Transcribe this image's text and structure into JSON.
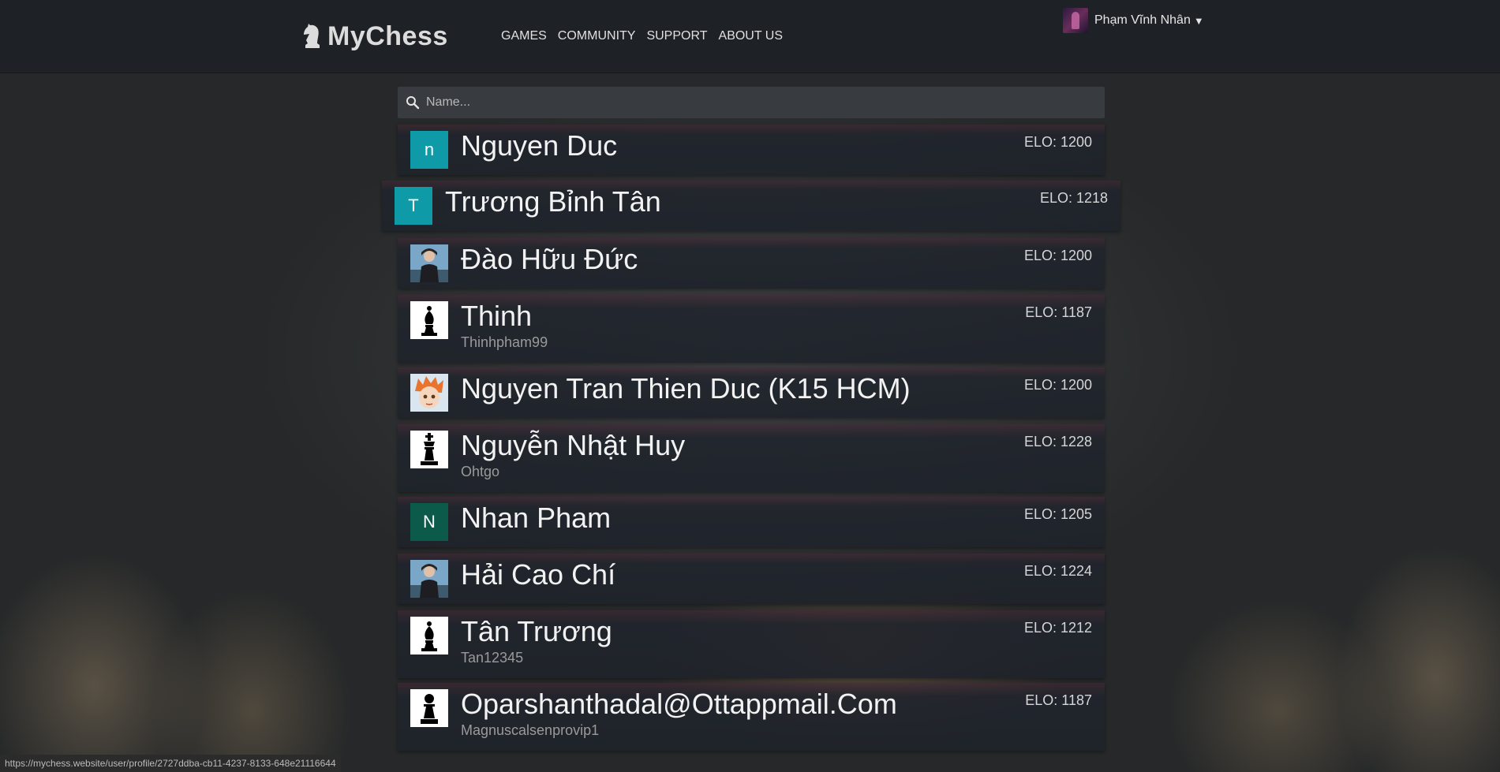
{
  "app": {
    "title": "MyChess",
    "nav": [
      "GAMES",
      "COMMUNITY",
      "SUPPORT",
      "ABOUT US"
    ],
    "user": {
      "name": "Phạm Vĩnh Nhân",
      "caret": "▼"
    }
  },
  "search": {
    "placeholder": "Name...",
    "value": ""
  },
  "players": [
    {
      "name": "Nguyen Duc",
      "username": "",
      "elo_label": "ELO: 1200",
      "avatar_letter": "n",
      "avatar_color": "#0e9aa7",
      "avatar_type": "letter"
    },
    {
      "name": "Trương Bỉnh Tân",
      "username": "",
      "elo_label": "ELO: 1218",
      "avatar_letter": "T",
      "avatar_color": "#0e9aa7",
      "avatar_type": "letter"
    },
    {
      "name": "Đào Hữu Đức",
      "username": "",
      "elo_label": "ELO: 1200",
      "avatar_letter": "",
      "avatar_color": "#5a8bb8",
      "avatar_type": "photo-person"
    },
    {
      "name": "Thinh",
      "username": "Thinhpham99",
      "elo_label": "ELO: 1187",
      "avatar_letter": "",
      "avatar_color": "#ffffff",
      "avatar_type": "bishop-piece"
    },
    {
      "name": "Nguyen Tran Thien Duc (K15 HCM)",
      "username": "",
      "elo_label": "ELO: 1200",
      "avatar_letter": "",
      "avatar_color": "#e07a3a",
      "avatar_type": "photo-anime"
    },
    {
      "name": "Nguyễn Nhật Huy",
      "username": "Ohtgo",
      "elo_label": "ELO: 1228",
      "avatar_letter": "",
      "avatar_color": "#ffffff",
      "avatar_type": "king-piece"
    },
    {
      "name": "Nhan Pham",
      "username": "",
      "elo_label": "ELO: 1205",
      "avatar_letter": "N",
      "avatar_color": "#0b5a4a",
      "avatar_type": "letter"
    },
    {
      "name": "Hải Cao Chí",
      "username": "",
      "elo_label": "ELO: 1224",
      "avatar_letter": "",
      "avatar_color": "#8a7f80",
      "avatar_type": "photo-person"
    },
    {
      "name": "Tân Trương",
      "username": "Tan12345",
      "elo_label": "ELO: 1212",
      "avatar_letter": "",
      "avatar_color": "#ffffff",
      "avatar_type": "bishop-piece"
    },
    {
      "name": "Oparshanthadal@Ottappmail.Com",
      "username": "Magnuscalsenprovip1",
      "elo_label": "ELO: 1187",
      "avatar_letter": "",
      "avatar_color": "#ffffff",
      "avatar_type": "pawn-piece"
    }
  ],
  "status_bar": {
    "url": "https://mychess.website/user/profile/2727ddba-cb11-4237-8133-648e21116644"
  },
  "colors": {
    "topbar": "#1e2125",
    "search_bg": "#383b40",
    "teal_avatar": "#0e9aa7"
  }
}
